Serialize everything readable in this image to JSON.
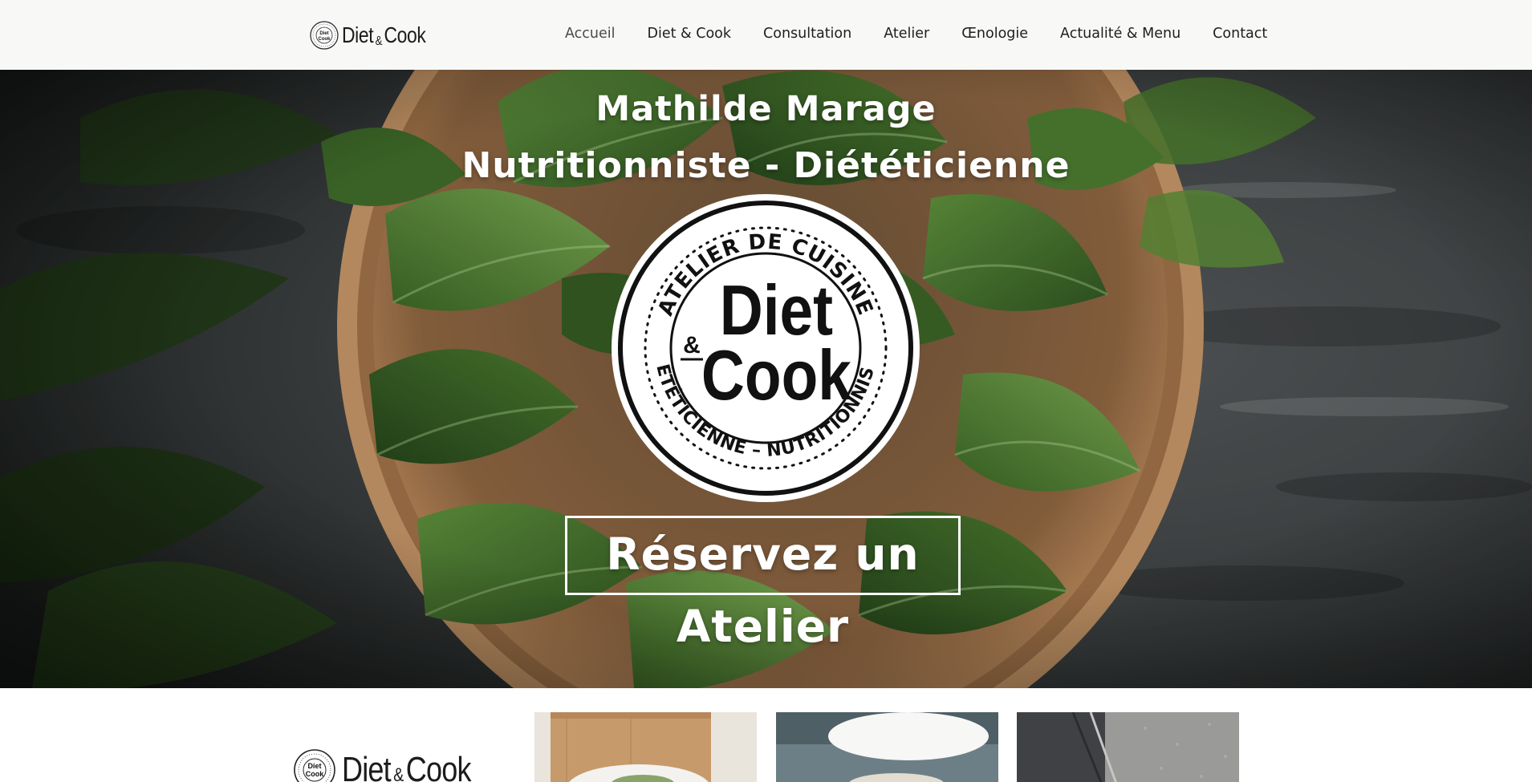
{
  "header": {
    "logo": {
      "word": "Diet",
      "amp": "&",
      "word2": "Cook",
      "seal_top": "Diet",
      "seal_bottom": "Cook"
    },
    "nav": [
      {
        "label": "Accueil",
        "active": true
      },
      {
        "label": "Diet & Cook"
      },
      {
        "label": "Consultation"
      },
      {
        "label": "Atelier"
      },
      {
        "label": "Œnologie"
      },
      {
        "label": "Actualité & Menu"
      },
      {
        "label": "Contact"
      }
    ]
  },
  "hero": {
    "title": "Mathilde Marage",
    "subtitle": "Nutritionniste - Diététicienne",
    "seal": {
      "ring_top": "ATELIER DE CUISINE",
      "ring_bottom": "DIÉTÉTICIENNE – NUTRITIONNISTE",
      "word1": "Diet",
      "amp": "&",
      "word2": "Cook"
    },
    "cta_label": "Réservez un Atelier"
  },
  "footer": {
    "logo": {
      "word": "Diet",
      "amp": "&",
      "word2": "Cook",
      "seal_top": "Diet",
      "seal_bottom": "Cook"
    }
  },
  "colors": {
    "header_bg": "#f8f8f7",
    "text_dark": "#1e1e1e",
    "hero_text": "#ffffff",
    "spinach_green": "#3f6b2a",
    "bowl_wood": "#a8784a"
  }
}
